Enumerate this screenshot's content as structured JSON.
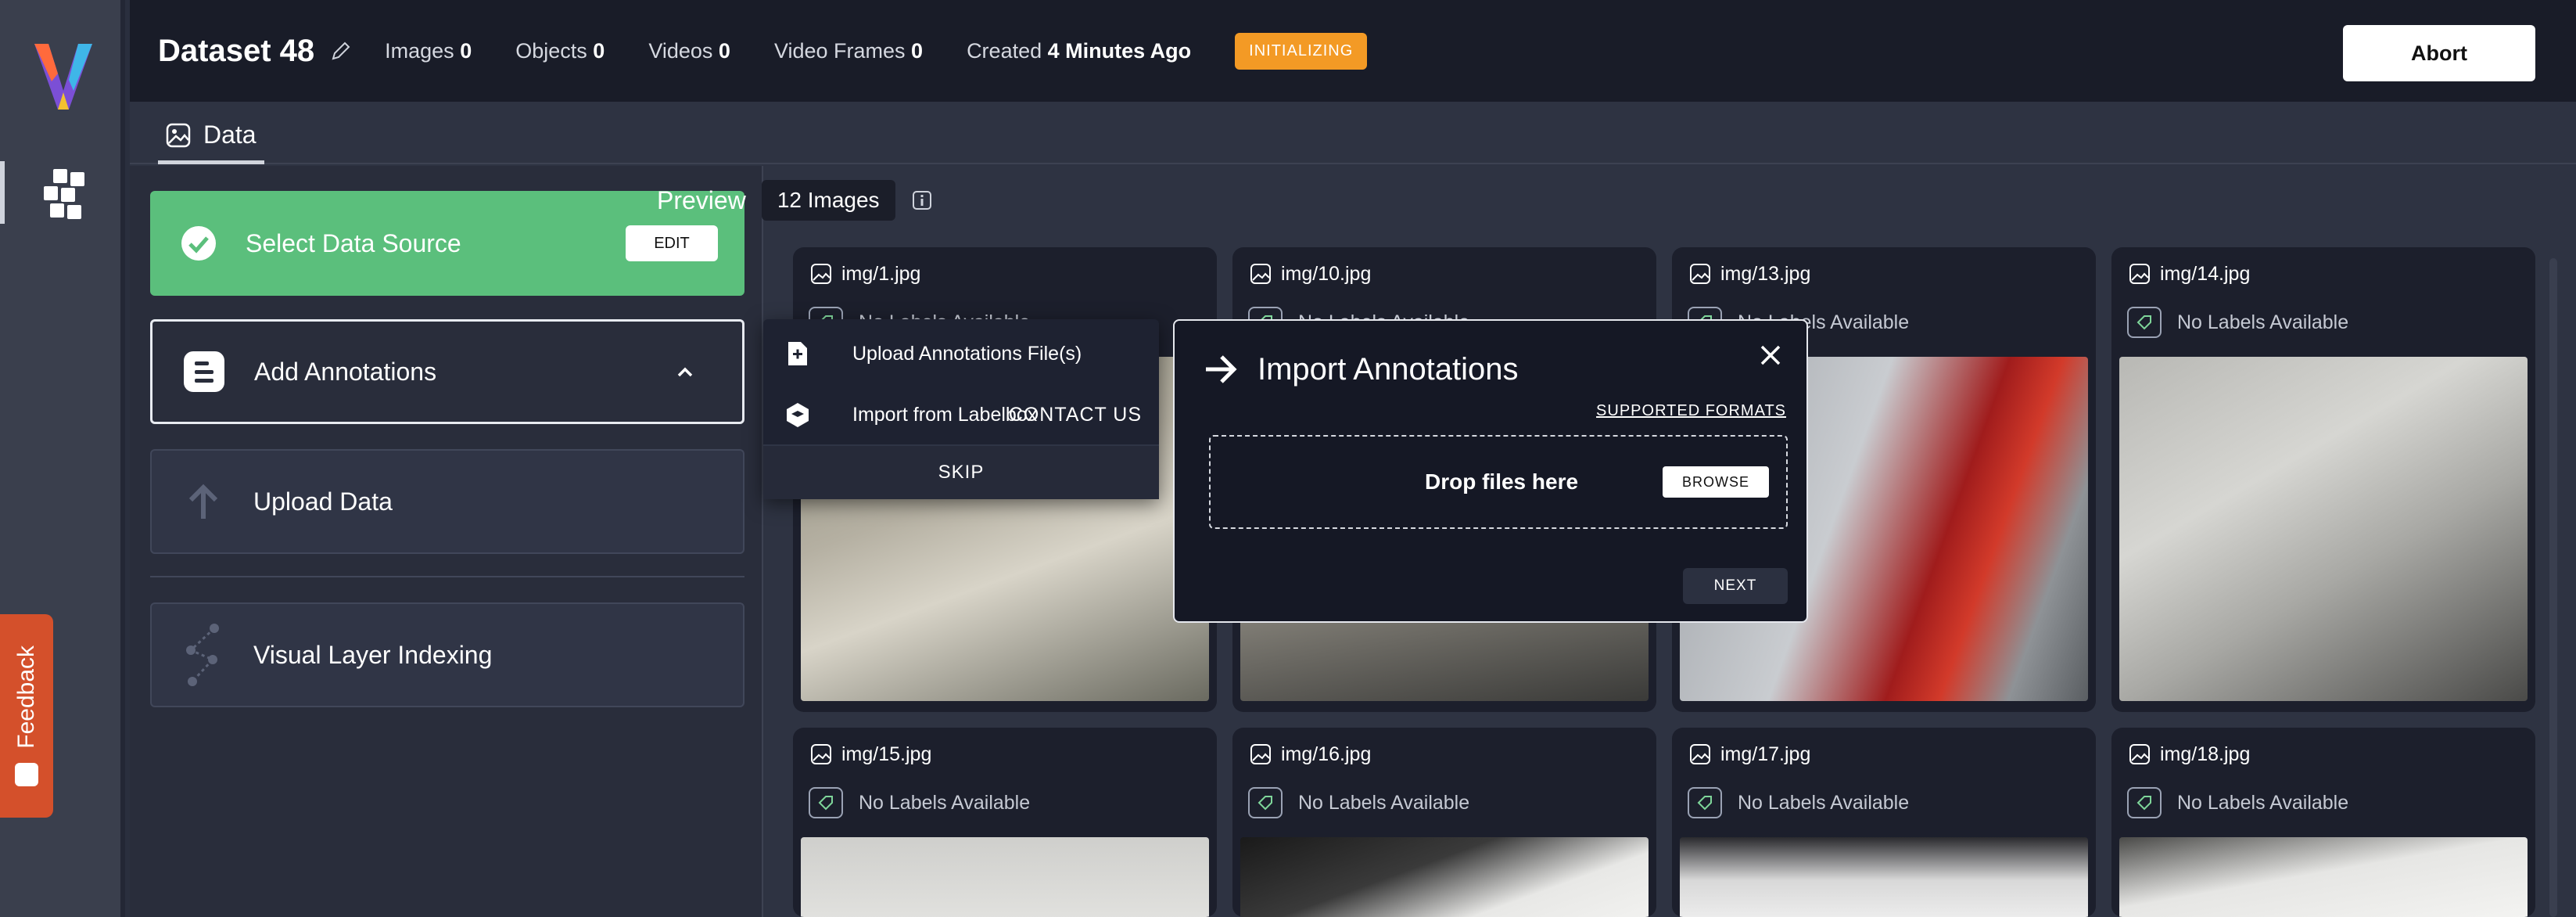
{
  "dataset": {
    "title": "Dataset 48",
    "stats": [
      {
        "label": "Images",
        "value": "0"
      },
      {
        "label": "Objects",
        "value": "0"
      },
      {
        "label": "Videos",
        "value": "0"
      },
      {
        "label": "Video Frames",
        "value": "0"
      },
      {
        "label": "Created",
        "value": "4 Minutes Ago"
      }
    ],
    "status": "INITIALIZING",
    "abort_label": "Abort"
  },
  "tabs": [
    {
      "label": "Data",
      "icon": "image-icon"
    }
  ],
  "sidebar": {
    "feedback_label": "Feedback"
  },
  "steps": {
    "select_source": {
      "label": "Select Data Source",
      "button": "EDIT"
    },
    "add_annotations": {
      "label": "Add Annotations"
    },
    "upload_data": {
      "label": "Upload Data"
    },
    "visual_layer": {
      "label": "Visual Layer Indexing"
    }
  },
  "preview": {
    "label": "Preview",
    "count": "12 Images"
  },
  "dropdown": {
    "upload_label": "Upload Annotations File(s)",
    "labelbox_label": "Import from Labelbox",
    "contact_label": "CONTACT US",
    "skip_label": "SKIP"
  },
  "modal": {
    "title": "Import Annotations",
    "formats_link": "SUPPORTED FORMATS",
    "drop_text": "Drop files here",
    "browse_label": "BROWSE",
    "next_label": "NEXT"
  },
  "cards": [
    {
      "name": "img/1.jpg",
      "labels": "No Labels Available"
    },
    {
      "name": "img/10.jpg",
      "labels": "No Labels Available"
    },
    {
      "name": "img/13.jpg",
      "labels": "No Labels Available"
    },
    {
      "name": "img/14.jpg",
      "labels": "No Labels Available"
    },
    {
      "name": "img/15.jpg",
      "labels": "No Labels Available"
    },
    {
      "name": "img/16.jpg",
      "labels": "No Labels Available"
    },
    {
      "name": "img/17.jpg",
      "labels": "No Labels Available"
    },
    {
      "name": "img/18.jpg",
      "labels": "No Labels Available"
    }
  ],
  "colors": {
    "accent_green": "#5bbf7c",
    "status_orange": "#f39a25",
    "feedback": "#d4502b",
    "topbar": "#191c28"
  }
}
